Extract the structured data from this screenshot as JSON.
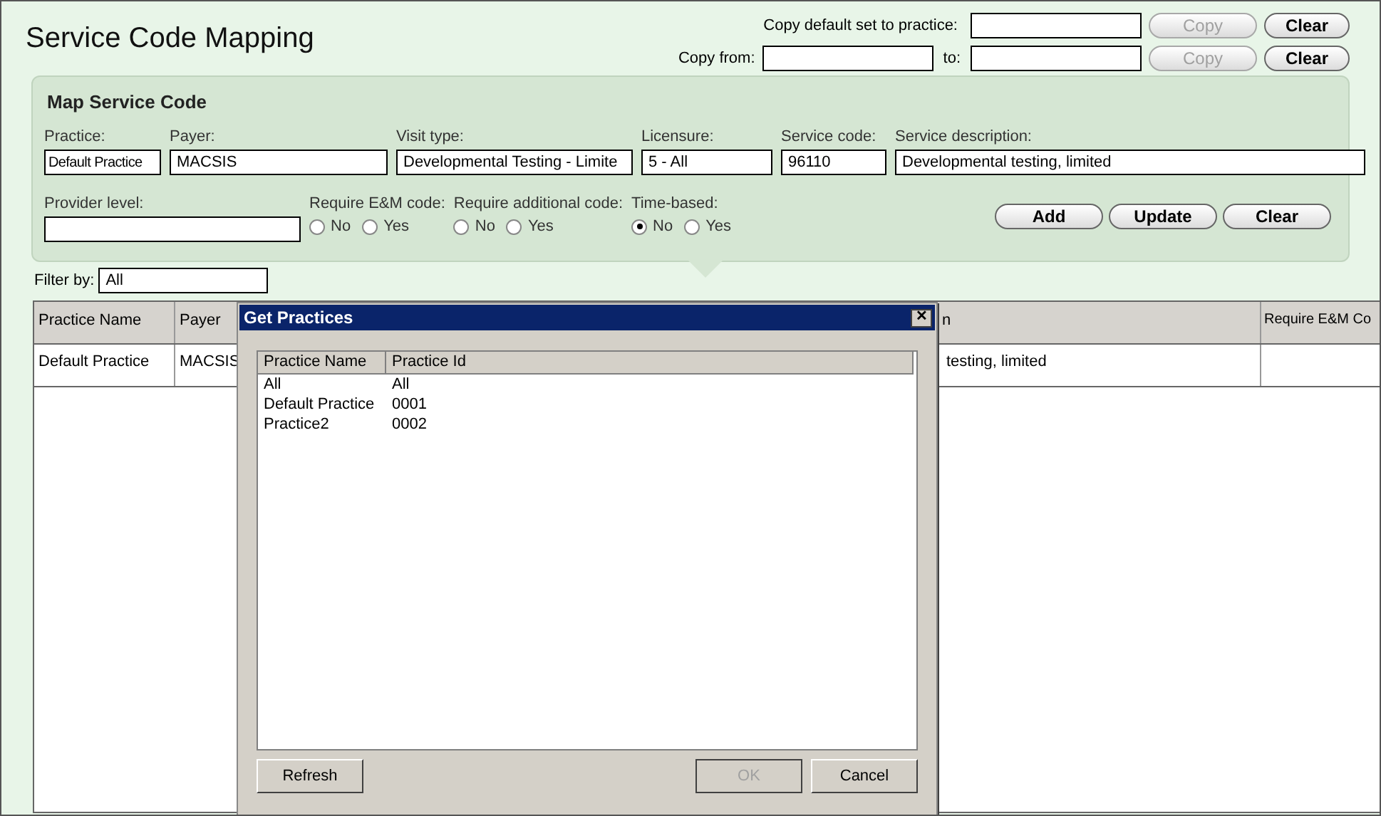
{
  "title": "Service Code Mapping",
  "copy_default": {
    "label": "Copy default set to practice:",
    "copy_button": {
      "label": "Copy",
      "disabled": true
    },
    "clear_button": {
      "label": "Clear",
      "disabled": false
    }
  },
  "copy_from": {
    "label": "Copy from:",
    "to_label": "to:",
    "copy_button": {
      "label": "Copy",
      "disabled": true
    },
    "clear_button": {
      "label": "Clear",
      "disabled": false
    }
  },
  "map_panel": {
    "title": "Map Service Code",
    "fields": [
      {
        "label": "Practice:",
        "value": "Default Practice"
      },
      {
        "label": "Payer:",
        "value": "MACSIS"
      },
      {
        "label": "Visit type:",
        "value": "Developmental Testing - Limite"
      },
      {
        "label": "Licensure:",
        "value": "5 - All"
      },
      {
        "label": "Service code:",
        "value": "96110"
      },
      {
        "label": "Service description:",
        "value": "Developmental testing, limited"
      }
    ],
    "provider_level": {
      "label": "Provider level:"
    },
    "radio_groups": [
      {
        "label": "Require E&M code:",
        "options": [
          {
            "label": "No",
            "selected": false
          },
          {
            "label": "Yes",
            "selected": false
          }
        ]
      },
      {
        "label": "Require additional code:",
        "options": [
          {
            "label": "No",
            "selected": false
          },
          {
            "label": "Yes",
            "selected": false
          }
        ]
      },
      {
        "label": "Time-based:",
        "options": [
          {
            "label": "No",
            "selected": true
          },
          {
            "label": "Yes",
            "selected": false
          }
        ]
      }
    ],
    "buttons": [
      "Add",
      "Update",
      "Clear"
    ]
  },
  "filter": {
    "label": "Filter by:",
    "value": "All"
  },
  "table": {
    "columns": [
      "Practice Name",
      "Payer",
      "n",
      "Require E&M Co"
    ],
    "rows": [
      [
        "Default Practice",
        "MACSIS",
        "testing, limited",
        ""
      ]
    ]
  },
  "dialog": {
    "title": "Get Practices",
    "close": "✕",
    "columns": [
      "Practice Name",
      "Practice Id"
    ],
    "rows": [
      [
        "All",
        "All"
      ],
      [
        "Default Practice",
        "0001"
      ],
      [
        "Practice2",
        "0002"
      ]
    ],
    "buttons": [
      {
        "label": "Refresh",
        "disabled": false
      },
      {
        "label": "OK",
        "disabled": true
      },
      {
        "label": "Cancel",
        "disabled": false
      }
    ]
  }
}
